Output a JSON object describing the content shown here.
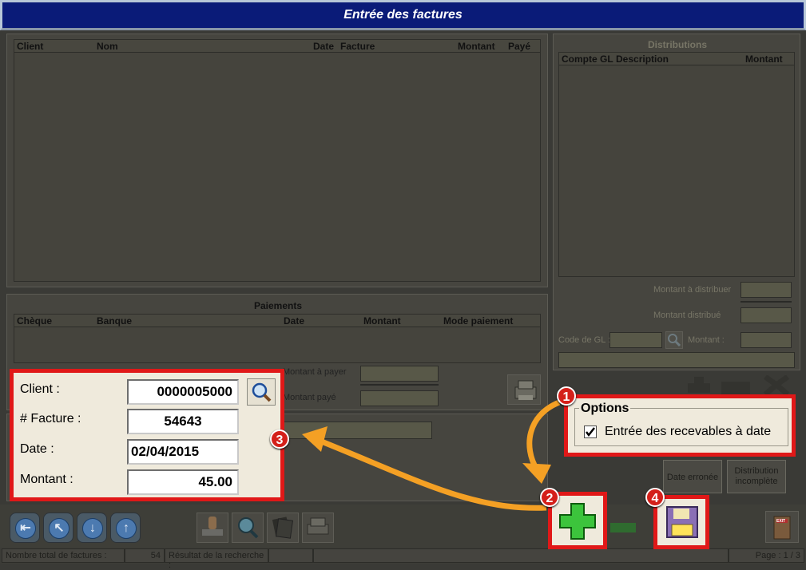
{
  "window": {
    "title": "Entrée des factures"
  },
  "invoice_list": {
    "columns": [
      "Client",
      "Nom",
      "Date",
      "Facture",
      "Montant",
      "Payé"
    ]
  },
  "payments": {
    "title": "Paiements",
    "columns": [
      "Chèque",
      "Banque",
      "Date",
      "Montant",
      "Mode paiement"
    ],
    "amount_to_pay_label": "Montant à payer",
    "amount_paid_label": "Montant payé"
  },
  "distributions": {
    "title": "Distributions",
    "columns": [
      "Compte GL",
      "Description",
      "Montant"
    ],
    "amount_to_distribute_label": "Montant à distribuer",
    "amount_distributed_label": "Montant distribué",
    "gl_code_label": "Code de GL :",
    "amount_label": "Montant :"
  },
  "invoice_form": {
    "client_label": "Client :",
    "client_value": "0000005000",
    "invoice_label": "# Facture :",
    "invoice_value": "54643",
    "date_label": "Date :",
    "date_value": "02/04/2015",
    "amount_label": "Montant  :",
    "amount_value": "45.00"
  },
  "options": {
    "title": "Options",
    "checkbox_label": "Entrée des recevables à date",
    "checked": true
  },
  "buttons": {
    "date_error": "Date erronée",
    "distribution_incomplete": "Distribution incomplète",
    "exit": "EXIT"
  },
  "badges": [
    "1",
    "2",
    "3",
    "4"
  ],
  "status_bar": {
    "total_label": "Nombre total de factures :",
    "total_value": "54",
    "search_label": "Résultat de la recherche :",
    "page": "Page : 1 / 3"
  },
  "colors": {
    "title_bar": "#0a1b78",
    "highlight": "#e01818",
    "arrow": "#f4a024",
    "add_green": "#3cc43c"
  },
  "icons": [
    "search-icon",
    "printer-icon",
    "plus-icon",
    "minus-icon",
    "delete-icon",
    "save-icon",
    "exit-icon",
    "nav-first-icon",
    "nav-prev-icon",
    "nav-next-icon",
    "nav-last-icon",
    "stamp-icon",
    "zoom-icon",
    "document-stack-icon"
  ]
}
